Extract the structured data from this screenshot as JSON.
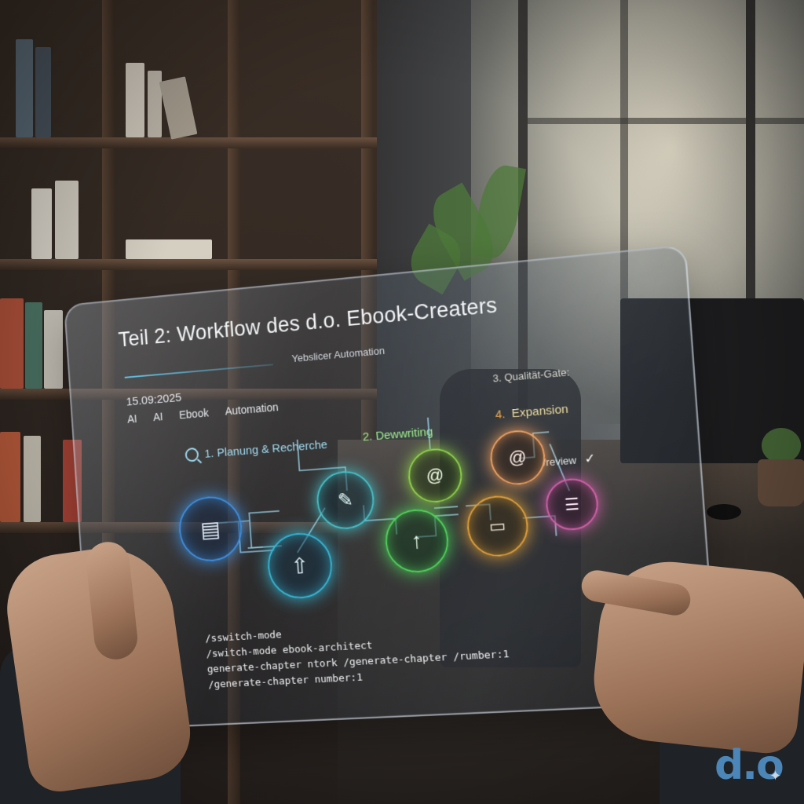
{
  "screen": {
    "title": "Teil 2: Workflow des d.o. Ebook-Creaters",
    "subtitle": "Yebslicer Automation",
    "date": "15.09:2025",
    "tags": [
      "AI",
      "AI",
      "Ebook",
      "Automation"
    ]
  },
  "steps": [
    {
      "label": "1. Planung & Recherche",
      "color": "#5fc3e8"
    },
    {
      "label": "2. Dewwriting",
      "color": "#7fe06a"
    },
    {
      "label": "3. Qualität-Gate:",
      "color": "#d8d6cc"
    },
    {
      "num": "4.",
      "label": "Expansion",
      "color": "#f0a94a"
    }
  ],
  "review": {
    "label": "/review",
    "icon": "check-icon"
  },
  "nodes": [
    {
      "icon": "document-icon",
      "color": "#3e8fe0"
    },
    {
      "icon": "upload-icon",
      "color": "#35b7d6"
    },
    {
      "icon": "pencil-icon",
      "color": "#46c0c8"
    },
    {
      "icon": "arrow-up-icon",
      "color": "#4fd35a"
    },
    {
      "icon": "spiral-icon",
      "color": "#8fd24a"
    },
    {
      "icon": "chart-icon",
      "color": "#e0a03a"
    },
    {
      "icon": "spiral-icon",
      "color": "#f0a060"
    },
    {
      "icon": "checklist-icon",
      "color": "#d05fa8"
    }
  ],
  "commands": [
    "/sswitch-mode",
    "/switch-mode ebook-architect",
    "generate-chapter ntork  /generate-chapter /rumber:1",
    "/generate-chapter number:1"
  ],
  "logo": {
    "text": "d.o"
  }
}
